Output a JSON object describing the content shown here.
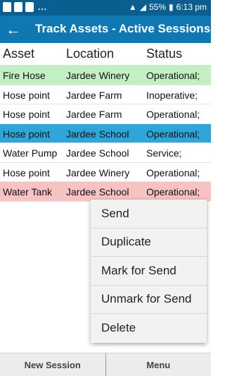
{
  "statusbar": {
    "dots": "...",
    "battery": "55%",
    "time": "6:13 pm"
  },
  "appbar": {
    "back_icon": "arrow-left",
    "title": "Track Assets - Active Sessions"
  },
  "table": {
    "headers": [
      "Asset",
      "Location",
      "Status"
    ],
    "rows": [
      {
        "asset": "Fire Hose",
        "location": "Jardee Winery",
        "status": "Operational;",
        "highlight": "#c2f0c2"
      },
      {
        "asset": "Hose point",
        "location": "Jardee Farm",
        "status": "Inoperative;",
        "highlight": ""
      },
      {
        "asset": "Hose point",
        "location": "Jardee Farm",
        "status": "Operational;",
        "highlight": ""
      },
      {
        "asset": "Hose point",
        "location": "Jardee School",
        "status": "Operational;",
        "highlight": "#2ea6d9"
      },
      {
        "asset": "Water Pump",
        "location": "Jardee School",
        "status": "Service;",
        "highlight": ""
      },
      {
        "asset": "Hose point",
        "location": "Jardee Winery",
        "status": "Operational;",
        "highlight": ""
      },
      {
        "asset": "Water Tank",
        "location": "Jardee School",
        "status": "Operational;",
        "highlight": "#f7c2c2"
      }
    ]
  },
  "context_menu": {
    "items": [
      "Send",
      "Duplicate",
      "Mark for Send",
      "Unmark for Send",
      "Delete"
    ]
  },
  "bottombar": {
    "new_session": "New Session",
    "menu": "Menu"
  },
  "colors": {
    "statusbar": "#0b5f90",
    "appbar": "#0f77b2"
  }
}
